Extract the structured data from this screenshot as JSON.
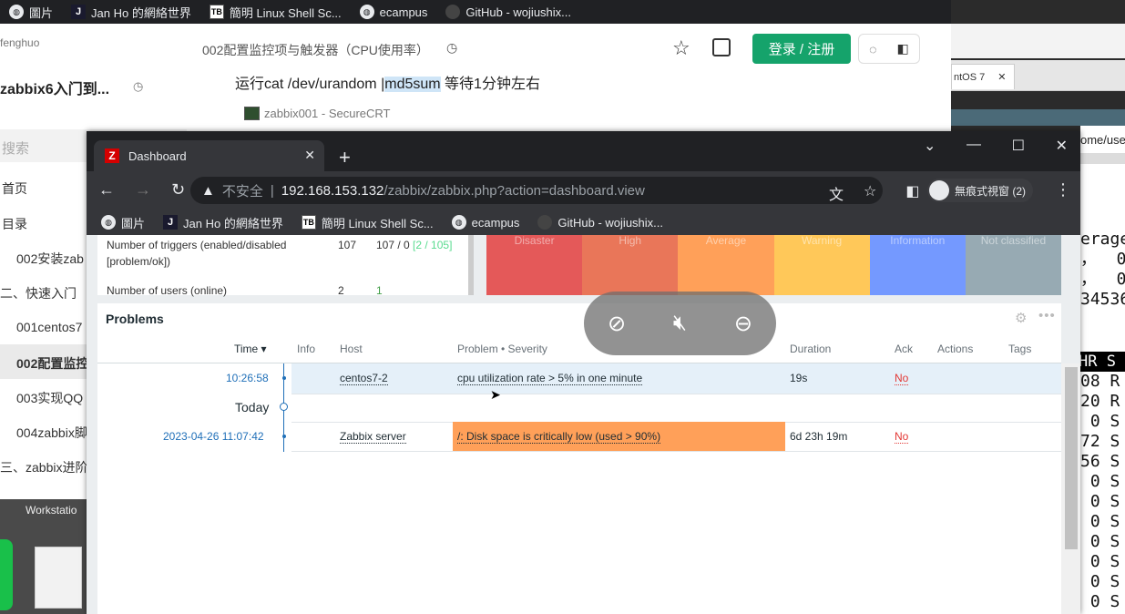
{
  "bg_bookmarks": [
    {
      "icon": "globe-icon",
      "label": "圖片"
    },
    {
      "icon": "j-icon",
      "label": "Jan Ho 的網絡世界"
    },
    {
      "icon": "tb-icon",
      "label": "簡明 Linux Shell Sc..."
    },
    {
      "icon": "globe-icon",
      "label": "ecampus"
    },
    {
      "icon": "github-icon",
      "label": "GitHub - wojiushix..."
    }
  ],
  "left_page": {
    "author": "fenghuo",
    "title": "zabbix6入门到...",
    "search": "搜索",
    "nav": [
      "首页",
      "目录",
      "002安装zab",
      "二、快速入门",
      "001centos7",
      "002配置监控",
      "003实现QQ",
      "004zabbix脚",
      "三、zabbix进阶"
    ],
    "desktop_label": "Workstatio"
  },
  "article": {
    "title": "002配置监控项与触发器（CPU使用率）",
    "login": "登录 / 注册",
    "cmd_prefix": "运行cat /dev/urandom |",
    "cmd_hl": "md5sum",
    "cmd_suffix": " 等待1分钟左右",
    "securecrt": "zabbix001 - SecureCRT"
  },
  "right": {
    "tab": "ntOS 7",
    "path": "ome/user",
    "term_lines": [
      "erage",
      "，  0",
      "，  0.",
      "34536"
    ],
    "term_hdr": "HR S",
    "term_rows": [
      "08 R",
      "20 R",
      " 0 S",
      "72 S",
      "56 S",
      " 0 S",
      " 0 S",
      " 0 S",
      " 0 S",
      " 0 S",
      " 0 S",
      " 0 S"
    ]
  },
  "chrome": {
    "tab_title": "Dashboard",
    "insecure": "不安全",
    "host": "192.168.153.132",
    "path": "/zabbix/zabbix.php?action=dashboard.view",
    "profile": "無痕式視窗 (2)",
    "bookmarks": [
      {
        "icon": "globe-icon",
        "label": "圖片"
      },
      {
        "icon": "j-icon",
        "label": "Jan Ho 的網絡世界"
      },
      {
        "icon": "tb-icon",
        "label": "簡明 Linux Shell Sc..."
      },
      {
        "icon": "globe-icon",
        "label": "ecampus"
      },
      {
        "icon": "github-icon",
        "label": "GitHub - wojiushix..."
      }
    ]
  },
  "sysinfo": {
    "label1": "Number of triggers (enabled/disabled",
    "label1b": "[problem/ok])",
    "v1": "107",
    "v1b": "107 / 0",
    "v1c": "[2 / 105]",
    "label2": "Number of users (online)",
    "v2": "2",
    "v2b": "1"
  },
  "severity": [
    {
      "label": "Disaster",
      "color": "#e45959"
    },
    {
      "label": "High",
      "color": "#e97659"
    },
    {
      "label": "Average",
      "color": "#ffa059"
    },
    {
      "label": "Warning",
      "color": "#ffc859"
    },
    {
      "label": "Information",
      "color": "#7499ff"
    },
    {
      "label": "Not classified",
      "color": "#97aab3"
    }
  ],
  "problems": {
    "title": "Problems",
    "headers": {
      "time": "Time ▾",
      "info": "Info",
      "host": "Host",
      "problem": "Problem • Severity",
      "duration": "Duration",
      "ack": "Ack",
      "actions": "Actions",
      "tags": "Tags"
    },
    "rows": [
      {
        "time": "10:26:58",
        "host": "centos7-2",
        "problem": "cpu utilization rate > 5% in one minute",
        "duration": "19s",
        "ack": "No"
      },
      {
        "time": "2023-04-26 11:07:42",
        "host": "Zabbix server",
        "problem": "/: Disk space is critically low (used > 90%)",
        "duration": "6d 23h 19m",
        "ack": "No"
      }
    ],
    "today": "Today"
  }
}
